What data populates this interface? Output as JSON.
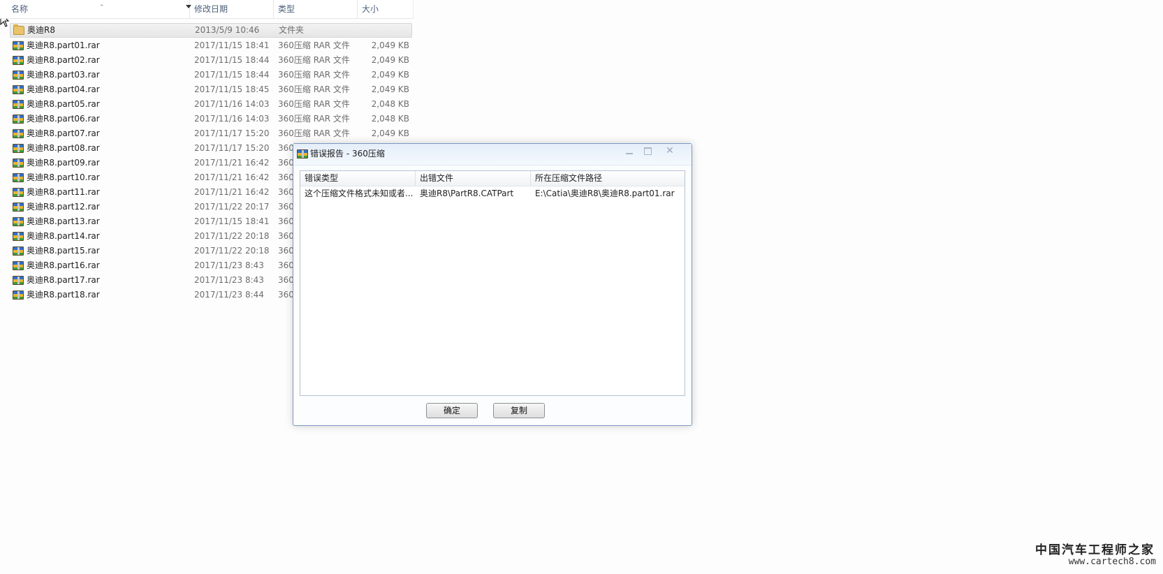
{
  "explorer": {
    "columns": {
      "name": "名称",
      "date": "修改日期",
      "type": "类型",
      "size": "大小"
    },
    "items": [
      {
        "name": "奥迪R8",
        "date": "2013/5/9 10:46",
        "type": "文件夹",
        "size": "",
        "icon": "folder-icon"
      },
      {
        "name": "奥迪R8.part01.rar",
        "date": "2017/11/15 18:41",
        "type": "360压缩 RAR 文件",
        "size": "2,049 KB",
        "icon": "rar-file-icon"
      },
      {
        "name": "奥迪R8.part02.rar",
        "date": "2017/11/15 18:44",
        "type": "360压缩 RAR 文件",
        "size": "2,049 KB",
        "icon": "rar-file-icon"
      },
      {
        "name": "奥迪R8.part03.rar",
        "date": "2017/11/15 18:44",
        "type": "360压缩 RAR 文件",
        "size": "2,049 KB",
        "icon": "rar-file-icon"
      },
      {
        "name": "奥迪R8.part04.rar",
        "date": "2017/11/15 18:45",
        "type": "360压缩 RAR 文件",
        "size": "2,049 KB",
        "icon": "rar-file-icon"
      },
      {
        "name": "奥迪R8.part05.rar",
        "date": "2017/11/16 14:03",
        "type": "360压缩 RAR 文件",
        "size": "2,048 KB",
        "icon": "rar-file-icon"
      },
      {
        "name": "奥迪R8.part06.rar",
        "date": "2017/11/16 14:03",
        "type": "360压缩 RAR 文件",
        "size": "2,048 KB",
        "icon": "rar-file-icon"
      },
      {
        "name": "奥迪R8.part07.rar",
        "date": "2017/11/17 15:20",
        "type": "360压缩 RAR 文件",
        "size": "2,049 KB",
        "icon": "rar-file-icon"
      },
      {
        "name": "奥迪R8.part08.rar",
        "date": "2017/11/17 15:20",
        "type": "360",
        "size": "",
        "icon": "rar-file-icon"
      },
      {
        "name": "奥迪R8.part09.rar",
        "date": "2017/11/21 16:42",
        "type": "360",
        "size": "",
        "icon": "rar-file-icon"
      },
      {
        "name": "奥迪R8.part10.rar",
        "date": "2017/11/21 16:42",
        "type": "360",
        "size": "",
        "icon": "rar-file-icon"
      },
      {
        "name": "奥迪R8.part11.rar",
        "date": "2017/11/21 16:42",
        "type": "360",
        "size": "",
        "icon": "rar-file-icon"
      },
      {
        "name": "奥迪R8.part12.rar",
        "date": "2017/11/22 20:17",
        "type": "360",
        "size": "",
        "icon": "rar-file-icon"
      },
      {
        "name": "奥迪R8.part13.rar",
        "date": "2017/11/15 18:41",
        "type": "360",
        "size": "",
        "icon": "rar-file-icon"
      },
      {
        "name": "奥迪R8.part14.rar",
        "date": "2017/11/22 20:18",
        "type": "360",
        "size": "",
        "icon": "rar-file-icon"
      },
      {
        "name": "奥迪R8.part15.rar",
        "date": "2017/11/22 20:18",
        "type": "360",
        "size": "",
        "icon": "rar-file-icon"
      },
      {
        "name": "奥迪R8.part16.rar",
        "date": "2017/11/23 8:43",
        "type": "360",
        "size": "",
        "icon": "rar-file-icon"
      },
      {
        "name": "奥迪R8.part17.rar",
        "date": "2017/11/23 8:43",
        "type": "360",
        "size": "",
        "icon": "rar-file-icon"
      },
      {
        "name": "奥迪R8.part18.rar",
        "date": "2017/11/23 8:44",
        "type": "360",
        "size": "",
        "icon": "rar-file-icon"
      }
    ]
  },
  "dialog": {
    "title": "错误报告 - 360压缩",
    "icon": "rar-app-icon",
    "columns": {
      "error_type": "错误类型",
      "error_file": "出错文件",
      "archive_path": "所在压缩文件路径"
    },
    "rows": [
      {
        "error_type": "这个压缩文件格式未知或者...",
        "error_file": "奥迪R8\\PartR8.CATPart",
        "archive_path": "E:\\Catia\\奥迪R8\\奥迪R8.part01.rar"
      }
    ],
    "buttons": {
      "ok": "确定",
      "copy": "复制"
    },
    "window_controls": {
      "minimize_icon": "minimize-icon",
      "maximize_icon": "maximize-icon",
      "close_icon": "close-icon"
    }
  },
  "watermark": {
    "title": "中国汽车工程师之家",
    "url": "www.cartech8.com"
  },
  "colors": {
    "dialog_border": "#7a98c0",
    "header_text": "#4c607a",
    "background": "#fdfdfd"
  }
}
